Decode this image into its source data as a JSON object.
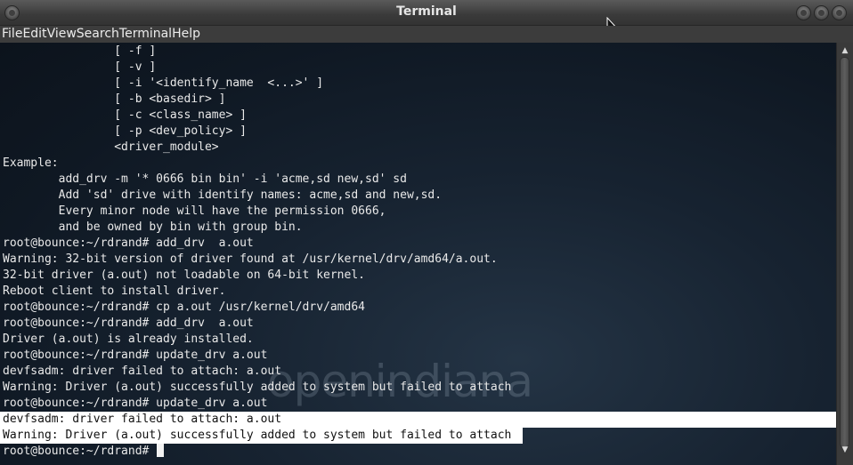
{
  "window": {
    "title": "Terminal"
  },
  "menu": [
    {
      "label": "File"
    },
    {
      "label": "Edit"
    },
    {
      "label": "View"
    },
    {
      "label": "Search"
    },
    {
      "label": "Terminal"
    },
    {
      "label": "Help"
    }
  ],
  "terminal": {
    "watermark": "openindiana",
    "lines": [
      "                [ -f ]",
      "                [ -v ]",
      "                [ -i '<identify_name  <...>' ]",
      "                [ -b <basedir> ]",
      "                [ -c <class_name> ]",
      "                [ -p <dev_policy> ]",
      "                <driver_module>",
      "Example:",
      "        add_drv -m '* 0666 bin bin' -i 'acme,sd new,sd' sd",
      "        Add 'sd' drive with identify names: acme,sd and new,sd.",
      "        Every minor node will have the permission 0666,",
      "        and be owned by bin with group bin.",
      "root@bounce:~/rdrand# add_drv  a.out",
      "Warning: 32-bit version of driver found at /usr/kernel/drv/amd64/a.out.",
      "32-bit driver (a.out) not loadable on 64-bit kernel.",
      "Reboot client to install driver.",
      "root@bounce:~/rdrand# cp a.out /usr/kernel/drv/amd64",
      "root@bounce:~/rdrand# add_drv  a.out",
      "Driver (a.out) is already installed.",
      "root@bounce:~/rdrand# update_drv a.out",
      "devfsadm: driver failed to attach: a.out",
      "Warning: Driver (a.out) successfully added to system but failed to attach",
      "root@bounce:~/rdrand# update_drv a.out",
      "devfsadm: driver failed to attach: a.out",
      "Warning: Driver (a.out) successfully added to system but failed to attach",
      "root@bounce:~/rdrand# "
    ]
  }
}
